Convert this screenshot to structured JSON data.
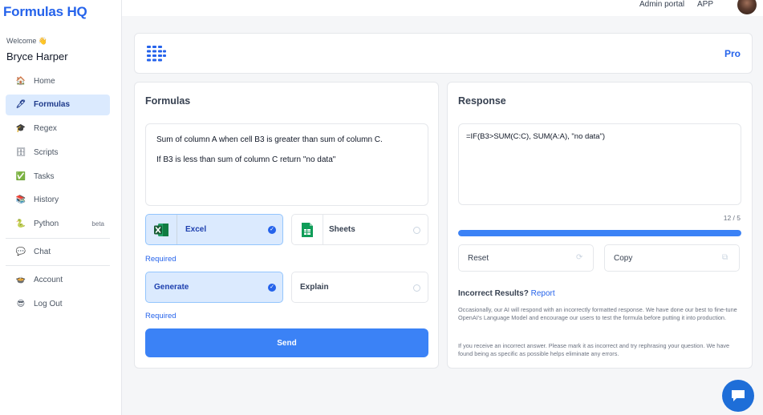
{
  "brand": "Formulas HQ",
  "welcome": "Welcome 👋",
  "username": "Bryce Harper",
  "nav": [
    {
      "label": "Home",
      "icon": "🏠",
      "icon_name": "home-icon"
    },
    {
      "label": "Formulas",
      "icon": "🖊",
      "icon_name": "pen-icon",
      "active": true
    },
    {
      "label": "Regex",
      "icon": "🎓",
      "icon_name": "graduation-cap-icon"
    },
    {
      "label": "Scripts",
      "icon": "🗄",
      "icon_name": "scroll-icon"
    },
    {
      "label": "Tasks",
      "icon": "✅",
      "icon_name": "check-icon"
    },
    {
      "label": "History",
      "icon": "📚",
      "icon_name": "books-icon"
    },
    {
      "label": "Python",
      "icon": "🐍",
      "icon_name": "python-icon",
      "badge": "beta"
    },
    {
      "label": "Chat",
      "icon": "💬",
      "icon_name": "chat-icon"
    },
    {
      "label": "Account",
      "icon": "🍲",
      "icon_name": "account-icon"
    },
    {
      "label": "Log Out",
      "icon": "😎",
      "icon_name": "logout-icon"
    }
  ],
  "topbar": {
    "admin_portal": "Admin portal",
    "app": "APP"
  },
  "header": {
    "plan": "Pro"
  },
  "formulas": {
    "title": "Formulas",
    "input_line1": "Sum of column A when cell B3 is greater than sum of column C.",
    "input_line2": "If B3 is less than sum of column C return \"no data\"",
    "platform_options": [
      {
        "label": "Excel",
        "selected": true
      },
      {
        "label": "Sheets",
        "selected": false
      }
    ],
    "required_1": "Required",
    "mode_options": [
      {
        "label": "Generate",
        "selected": true
      },
      {
        "label": "Explain",
        "selected": false
      }
    ],
    "required_2": "Required",
    "send_label": "Send"
  },
  "response": {
    "title": "Response",
    "output": "=IF(B3>SUM(C:C), SUM(A:A), \"no data\")",
    "counter": "12 / 5",
    "progress_fraction": 1.0,
    "reset_label": "Reset",
    "copy_label": "Copy",
    "incorrect_label": "Incorrect Results?",
    "report_label": "Report",
    "fine_print_1": "Occasionally, our AI will respond with an incorrectly formatted response. We have done our best to fine-tune OpenAI's  Language Model and encourage our users to test the formula before putting it into production.",
    "fine_print_2": "If you receive an incorrect answer. Please mark it as incorrect and try rephrasing your question. We have found being as specific as possible helps eliminate any errors."
  },
  "colors": {
    "accent": "#2563eb",
    "selected_bg": "#dbeafe",
    "button": "#3b82f6",
    "excel_green": "#1d6f42",
    "sheets_green": "#0f9d58"
  }
}
